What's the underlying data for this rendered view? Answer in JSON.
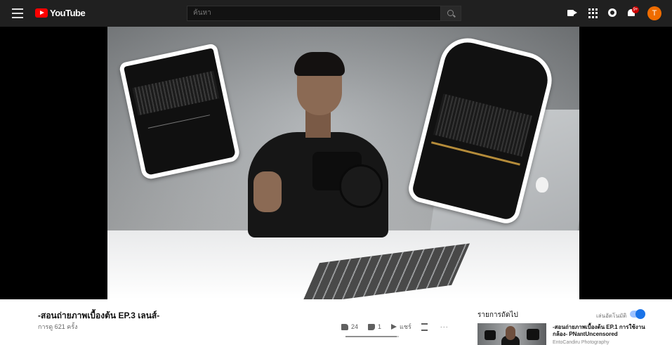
{
  "header": {
    "logo_text": "YouTube",
    "search_placeholder": "ค้นหา",
    "notification_count": "9+",
    "avatar_letter": "T"
  },
  "video": {
    "title": "-สอนถ่ายภาพเบื้องต้น EP.3 เลนส์-",
    "views": "การดู 621 ครั้ง"
  },
  "actions": {
    "likes": "24",
    "dislikes": "1",
    "share_label": "แชร์",
    "save_label": "",
    "more_label": "···",
    "like_ratio": 0.96
  },
  "up_next": {
    "heading": "รายการถัดไป",
    "autoplay_label": "เล่นอัตโนมัติ",
    "autoplay_on": true,
    "item": {
      "title": "-สอนถ่ายภาพเบื้องต้น EP.1 การใช้งานกล้อง- PNantUncensored",
      "channel": "EntoCandiru Photography"
    }
  },
  "colors": {
    "topbar": "#202020",
    "brand_red": "#ff0000",
    "avatar": "#ef6c00",
    "toggle": "#1a73e8"
  }
}
